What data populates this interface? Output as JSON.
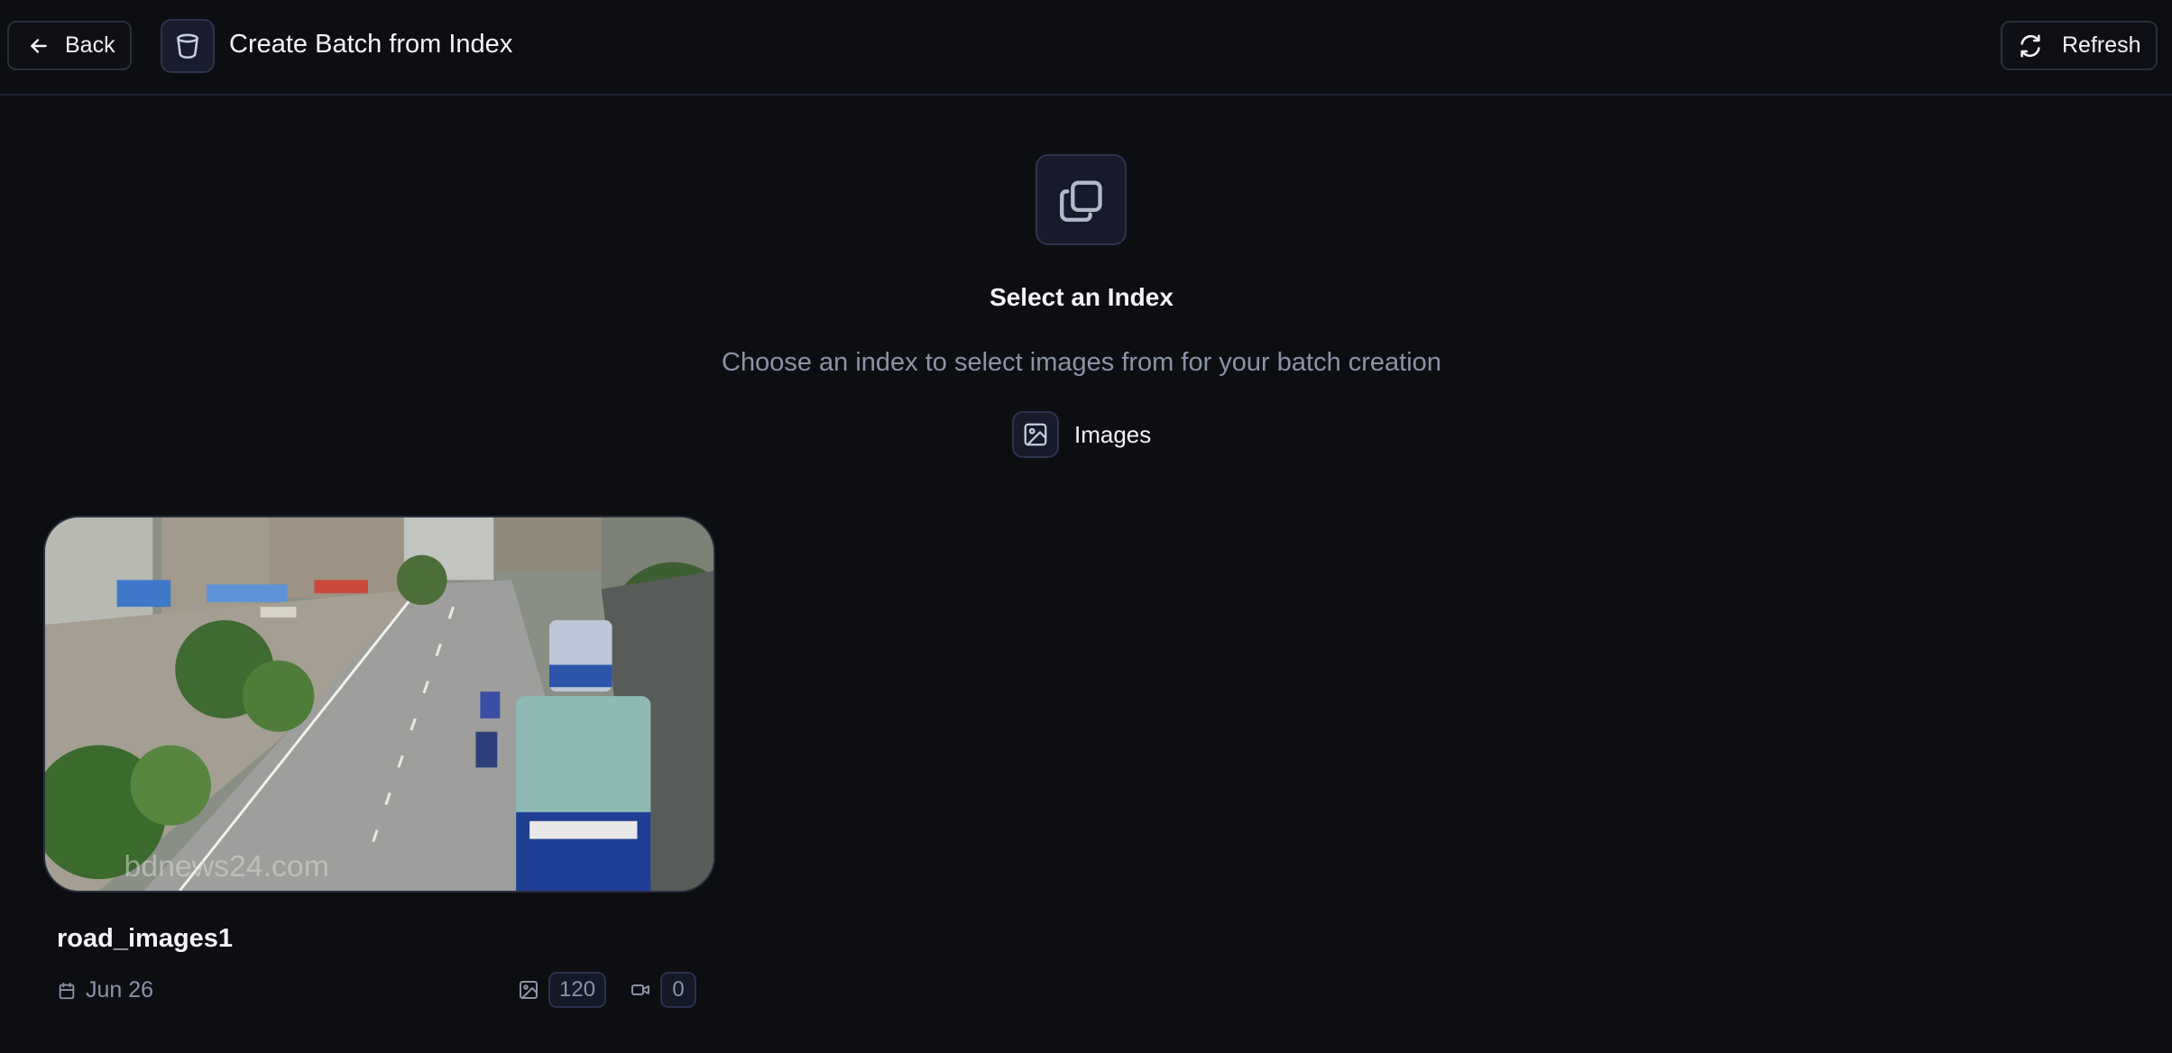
{
  "header": {
    "back_label": "Back",
    "title": "Create Batch from Index",
    "refresh_label": "Refresh"
  },
  "hero": {
    "title": "Select an Index",
    "subtitle": "Choose an index to select images from for your batch creation",
    "type_label": "Images"
  },
  "indexes": [
    {
      "name": "road_images1",
      "date": "Jun 26",
      "image_count": "120",
      "video_count": "0"
    }
  ],
  "colors": {
    "background": "#0d0e12",
    "border": "#2a2f3c",
    "accent_tile": "#161a29",
    "muted_text": "#8b93a7"
  },
  "icons": {
    "back": "arrow-left-icon",
    "title": "bucket-icon",
    "refresh": "refresh-icon",
    "hero": "copy-icon",
    "type": "image-icon",
    "date": "calendar-icon",
    "video": "video-icon"
  }
}
